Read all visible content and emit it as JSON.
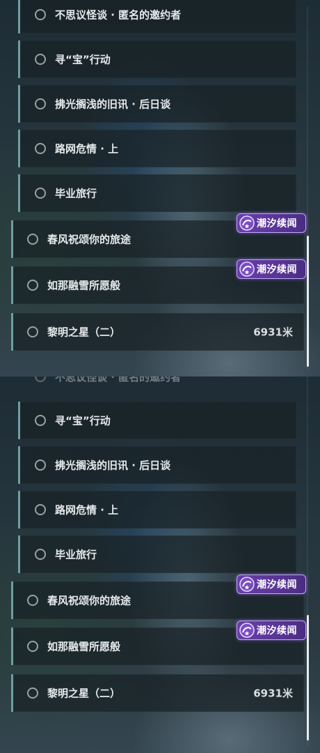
{
  "quest_list_top": {
    "quests": [
      {
        "label": "不思议怪谈 · 匿名的邀约者"
      },
      {
        "label": "寻“宝”行动"
      },
      {
        "label": "拂光搁浅的旧讯 · 后日谈"
      },
      {
        "label": "路网危情 · 上"
      },
      {
        "label": "毕业旅行"
      },
      {
        "label": "春风祝颂你的旅途",
        "badge": "潮汐续闻"
      },
      {
        "label": "如那融雪所愿般",
        "badge": "潮汐续闻"
      },
      {
        "label": "黎明之星（二）",
        "distance": "6931米"
      }
    ]
  },
  "quest_list_bottom": {
    "faded_label": "不思议怪谈 · 匿名的邀约者",
    "quests": [
      {
        "label": "寻“宝”行动"
      },
      {
        "label": "拂光搁浅的旧讯 · 后日谈"
      },
      {
        "label": "路网危情 · 上"
      },
      {
        "label": "毕业旅行"
      },
      {
        "label": "春风祝颂你的旅途",
        "badge": "潮汐续闻"
      },
      {
        "label": "如那融雪所愿般",
        "badge": "潮汐续闻"
      },
      {
        "label": "黎明之星（二）",
        "distance": "6931米"
      }
    ]
  },
  "colors": {
    "accent_bar": "#6f9ea4",
    "badge_purple": "#5a3697",
    "badge_border": "#c3a8ff",
    "text": "#e6eaec"
  },
  "icons": {
    "quest_status": "ring-icon",
    "badge": "star-swirl-icon"
  }
}
